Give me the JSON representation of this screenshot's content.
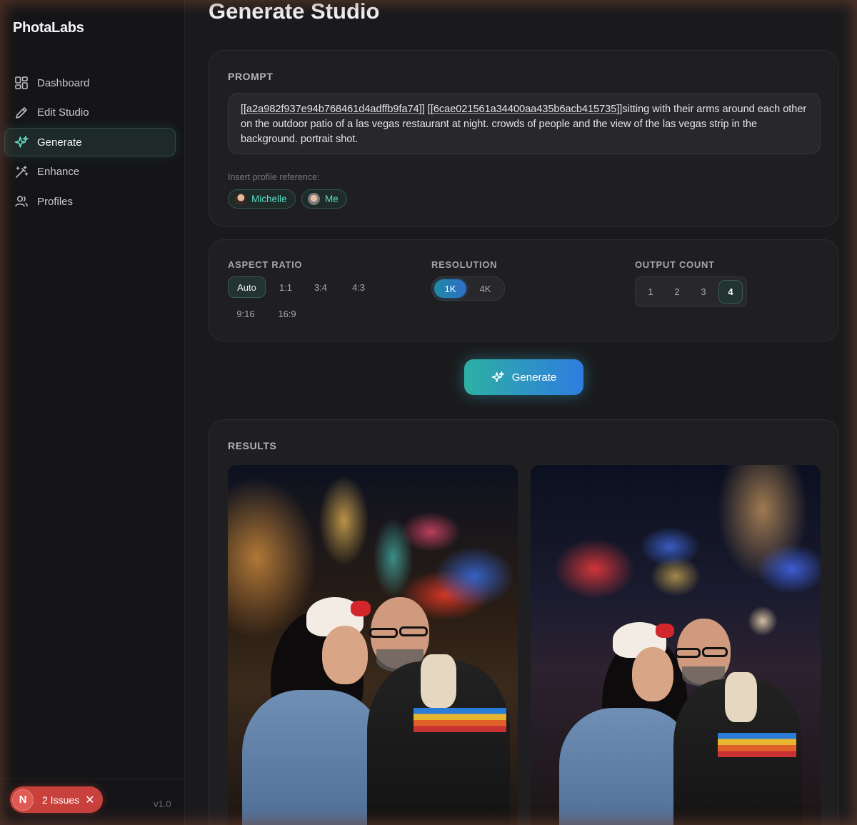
{
  "app": {
    "brand": "PhotaLabs",
    "version": "v1.0"
  },
  "sidebar": {
    "items": [
      {
        "label": "Dashboard",
        "icon": "dashboard-icon",
        "active": false
      },
      {
        "label": "Edit Studio",
        "icon": "pencil-icon",
        "active": false
      },
      {
        "label": "Generate",
        "icon": "sparkles-icon",
        "active": true
      },
      {
        "label": "Enhance",
        "icon": "magic-wand-icon",
        "active": false
      },
      {
        "label": "Profiles",
        "icon": "users-icon",
        "active": false
      }
    ]
  },
  "issues": {
    "badge": "N",
    "label": "2 Issues",
    "close": "✕"
  },
  "page": {
    "title": "Generate Studio"
  },
  "prompt": {
    "label": "PROMPT",
    "ref1": "[[a2a982f937e94b768461d4adffb9fa74]]",
    "ref2": "[[6cae021561a34400aa435b6acb415735]]",
    "text": "sitting with their arms around each other on the outdoor patio of a las vegas restaurant at night. crowds of people and the view of the las vegas strip in the background. portrait shot.",
    "insert_label": "Insert profile reference:",
    "profiles": [
      "Michelle",
      "Me"
    ]
  },
  "options": {
    "aspect_ratio": {
      "label": "ASPECT RATIO",
      "options": [
        "Auto",
        "1:1",
        "3:4",
        "4:3",
        "9:16",
        "16:9"
      ],
      "selected": "Auto"
    },
    "resolution": {
      "label": "RESOLUTION",
      "options": [
        "1K",
        "4K"
      ],
      "selected": "1K"
    },
    "output_count": {
      "label": "OUTPUT COUNT",
      "options": [
        "1",
        "2",
        "3",
        "4"
      ],
      "selected": "4"
    }
  },
  "generate_button": {
    "label": "Generate"
  },
  "results": {
    "label": "RESULTS"
  },
  "colors": {
    "accent": "#5fd9c2",
    "gradient_start": "#2db0a4",
    "gradient_end": "#2f7ce0",
    "issue_red": "#c9413c"
  }
}
